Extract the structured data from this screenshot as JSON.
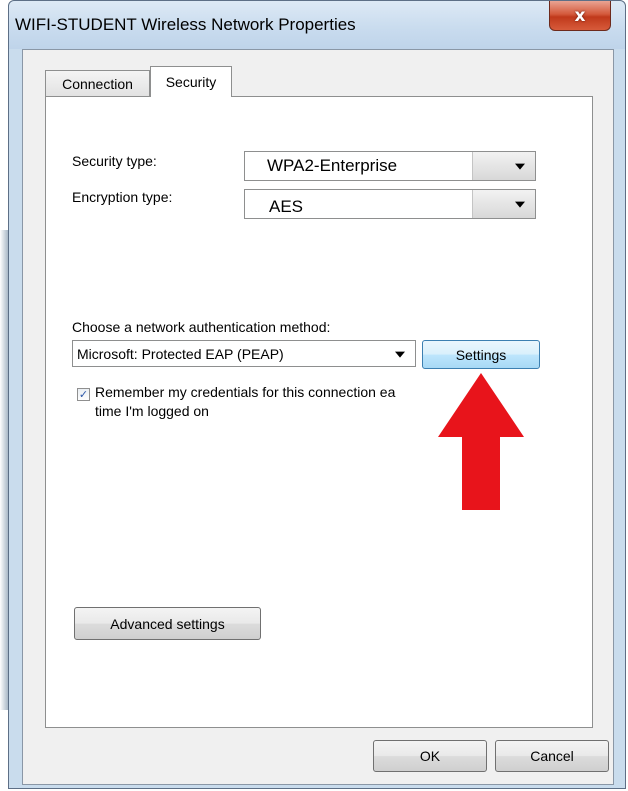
{
  "window": {
    "title": "WIFI-STUDENT Wireless Network Properties",
    "close_symbol": "x"
  },
  "tabs": [
    {
      "label": "Connection",
      "selected": false
    },
    {
      "label": "Security",
      "selected": true
    }
  ],
  "security": {
    "security_type_label": "Security type:",
    "security_type_value": "WPA2-Enterprise",
    "encryption_type_label": "Encryption type:",
    "encryption_type_value": "AES",
    "auth_method_label": "Choose a network authentication method:",
    "auth_method_value": "Microsoft: Protected EAP (PEAP)",
    "settings_button": "Settings",
    "remember_line1": "Remember my credentials for this connection ea",
    "remember_line2": "time I'm logged on",
    "remember_checked": true,
    "advanced_button": "Advanced settings"
  },
  "footer": {
    "ok_button": "OK",
    "cancel_button": "Cancel"
  },
  "annotation": {
    "arrow_color": "#e8141b",
    "arrow_icon": "red-up-arrow-icon"
  },
  "colors": {
    "title_bar": "#c8dbee",
    "close_button": "#c7432a",
    "settings_highlight": "#bee6fd"
  }
}
